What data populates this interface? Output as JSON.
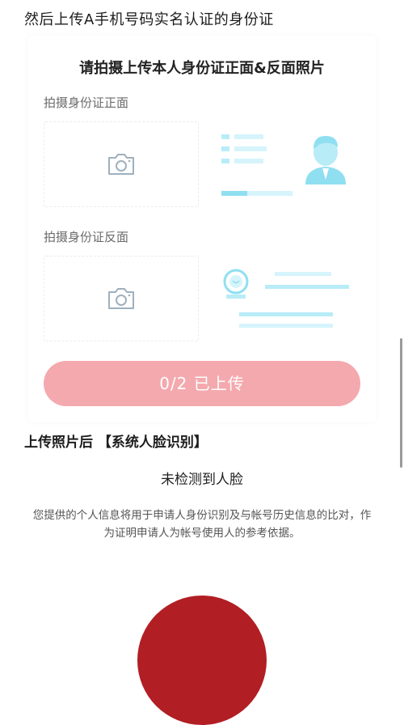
{
  "page": {
    "title": "然后上传A手机号码实名认证的身份证"
  },
  "card": {
    "title": "请拍摄上传本人身份证正面&反面照片",
    "front_label": "拍摄身份证正面",
    "back_label": "拍摄身份证反面",
    "upload_button": "0/2 已上传",
    "colors": {
      "button": "#f4a9ae",
      "sample_light": "#d6f4fb",
      "sample_mid": "#b8ecf7",
      "sample_dark": "#6cd6ee"
    },
    "upload_count": {
      "uploaded": 0,
      "total": 2
    }
  },
  "face": {
    "title": "上传照片后 【系统人脸识别】",
    "status": "未检测到人脸",
    "notice": "您提供的个人信息将用于申请人身份识别及与帐号历史信息的比对，作为证明申请人为帐号使用人的参考依据。"
  },
  "icons": {
    "camera": "camera-icon",
    "avatar": "person-avatar-icon",
    "emblem": "national-emblem-icon"
  }
}
